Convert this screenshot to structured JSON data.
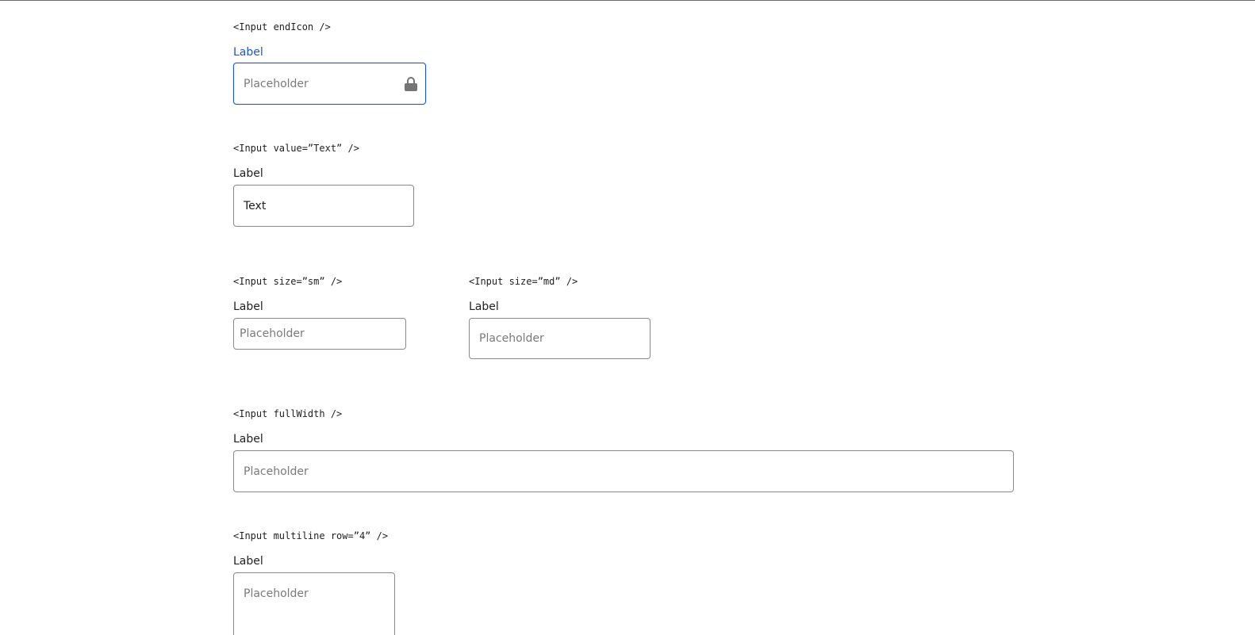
{
  "sections": {
    "end_icon": {
      "code": "<Input endIcon />",
      "label": "Label",
      "placeholder": "Placeholder",
      "icon": "lock-icon"
    },
    "value": {
      "code": "<Input value=”Text” />",
      "label": "Label",
      "value": "Text"
    },
    "size_sm": {
      "code": "<Input size=”sm” />",
      "label": "Label",
      "placeholder": "Placeholder"
    },
    "size_md": {
      "code": "<Input size=”md” />",
      "label": "Label",
      "placeholder": "Placeholder"
    },
    "full_width": {
      "code": "<Input fullWidth />",
      "label": "Label",
      "placeholder": "Placeholder"
    },
    "multiline": {
      "code": "<Input multiline row=”4” />",
      "label": "Label",
      "placeholder": "Placeholder"
    }
  },
  "colors": {
    "focus": "#1a56db",
    "border": "#8a8a8a",
    "icon": "#757575"
  }
}
